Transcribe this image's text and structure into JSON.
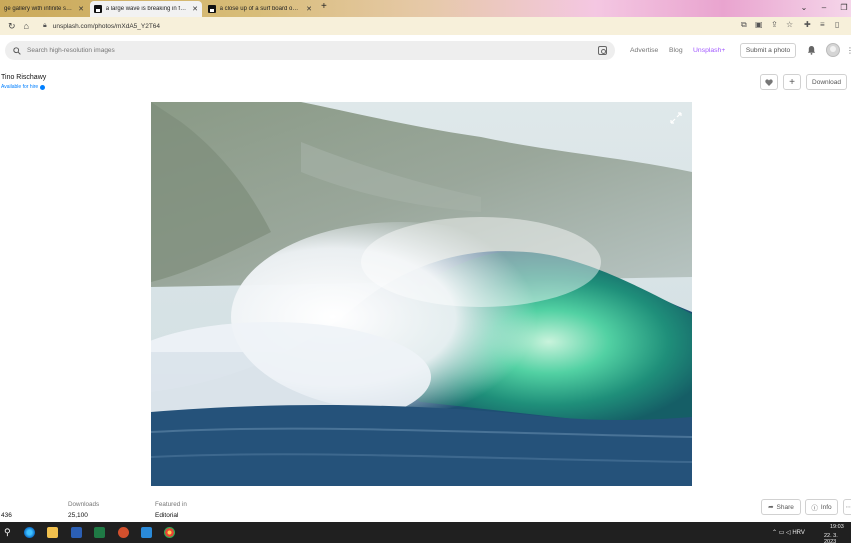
{
  "browser": {
    "tabs": [
      {
        "title": "ge gallery with infinite scroll",
        "active": false
      },
      {
        "title": "a large wave is breaking in front",
        "active": true
      },
      {
        "title": "a close up of a surf board on a b",
        "active": false
      }
    ],
    "new_tab_symbol": "+",
    "url": "unsplash.com/photos/mXdA5_Y2T64"
  },
  "header": {
    "search_placeholder": "Search high-resolution images",
    "nav": {
      "advertise": "Advertise",
      "blog": "Blog",
      "unsplash_plus": "Unsplash+"
    },
    "submit_photo": "Submit a photo"
  },
  "photographer": {
    "name": "Tino Rischawy",
    "status": "Available for hire"
  },
  "actions": {
    "download": "Download"
  },
  "stats": {
    "views_value": "436",
    "downloads_label": "Downloads",
    "downloads_value": "25,100",
    "featured_label": "Featured in",
    "featured_value": "Editorial",
    "share": "Share",
    "info": "Info"
  },
  "taskbar": {
    "language": "HRV",
    "time": "19:03",
    "date": "22. 3. 2023"
  },
  "colors": {
    "unsplash_plus": "#a259ff",
    "hire_blue": "#007fff",
    "taskbar": "#202020"
  }
}
